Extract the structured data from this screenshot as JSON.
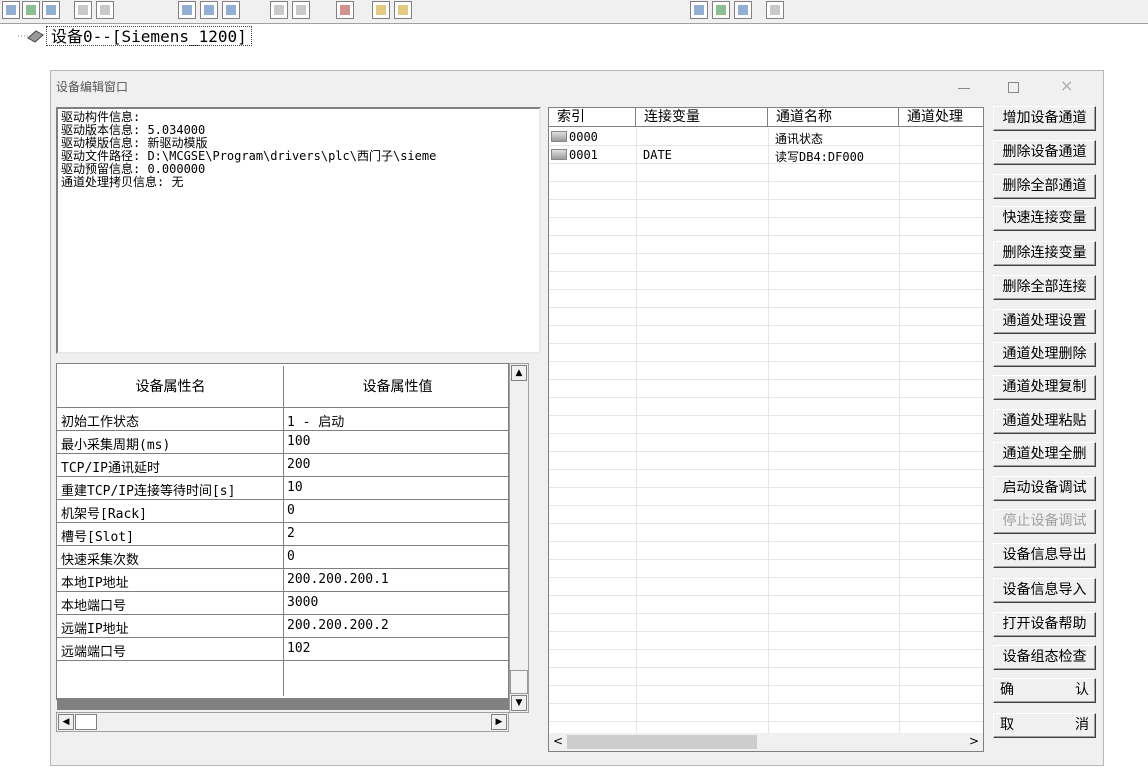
{
  "toolbar": {
    "icons": [
      "open-icon",
      "group-icon",
      "save-icon",
      "print-icon",
      "preview-icon",
      "cut-icon",
      "copy-icon",
      "paste-icon",
      "undo-icon",
      "redo-icon",
      "tools-icon",
      "link-icon",
      "link2-icon",
      "props-icon",
      "check-icon",
      "sort-icon",
      "help-icon"
    ]
  },
  "tree": {
    "device_label": "设备0--[Siemens_1200]"
  },
  "window": {
    "title": "设备编辑窗口"
  },
  "info": {
    "lines": [
      "驱动构件信息:",
      "驱动版本信息: 5.034000",
      "驱动模版信息: 新驱动模版",
      "驱动文件路径: D:\\MCGSE\\Program\\drivers\\plc\\西门子\\sieme",
      "驱动预留信息: 0.000000",
      "通道处理拷贝信息: 无"
    ]
  },
  "properties": {
    "header_name": "设备属性名",
    "header_value": "设备属性值",
    "rows": [
      {
        "name": "初始工作状态",
        "value": "1 - 启动"
      },
      {
        "name": "最小采集周期(ms)",
        "value": "100"
      },
      {
        "name": "TCP/IP通讯延时",
        "value": "200"
      },
      {
        "name": "重建TCP/IP连接等待时间[s]",
        "value": "10"
      },
      {
        "name": "机架号[Rack]",
        "value": "0"
      },
      {
        "name": "槽号[Slot]",
        "value": "2"
      },
      {
        "name": "快速采集次数",
        "value": "0"
      },
      {
        "name": "本地IP地址",
        "value": "200.200.200.1"
      },
      {
        "name": "本地端口号",
        "value": "3000"
      },
      {
        "name": "远端IP地址",
        "value": "200.200.200.2"
      },
      {
        "name": "远端端口号",
        "value": "102"
      }
    ]
  },
  "channels": {
    "headers": [
      "索引",
      "连接变量",
      "通道名称",
      "通道处理"
    ],
    "rows": [
      {
        "index": "0000",
        "var": "",
        "name": "通讯状态",
        "proc": ""
      },
      {
        "index": "0001",
        "var": "DATE",
        "name": "读写DB4:DF000",
        "proc": ""
      }
    ]
  },
  "buttons": [
    {
      "label": "增加设备通道",
      "enabled": true
    },
    {
      "label": "删除设备通道",
      "enabled": true
    },
    {
      "label": "删除全部通道",
      "enabled": true
    },
    {
      "label": "快速连接变量",
      "enabled": true
    },
    {
      "label": "删除连接变量",
      "enabled": true
    },
    {
      "label": "删除全部连接",
      "enabled": true
    },
    {
      "label": "通道处理设置",
      "enabled": true
    },
    {
      "label": "通道处理删除",
      "enabled": true
    },
    {
      "label": "通道处理复制",
      "enabled": true
    },
    {
      "label": "通道处理粘贴",
      "enabled": true
    },
    {
      "label": "通道处理全删",
      "enabled": true
    },
    {
      "label": "启动设备调试",
      "enabled": true
    },
    {
      "label": "停止设备调试",
      "enabled": false
    },
    {
      "label": "设备信息导出",
      "enabled": true
    },
    {
      "label": "设备信息导入",
      "enabled": true
    },
    {
      "label": "打开设备帮助",
      "enabled": true
    },
    {
      "label": "设备组态检查",
      "enabled": true
    },
    {
      "label": "确 认",
      "enabled": true
    },
    {
      "label": "取 消",
      "enabled": true
    }
  ]
}
